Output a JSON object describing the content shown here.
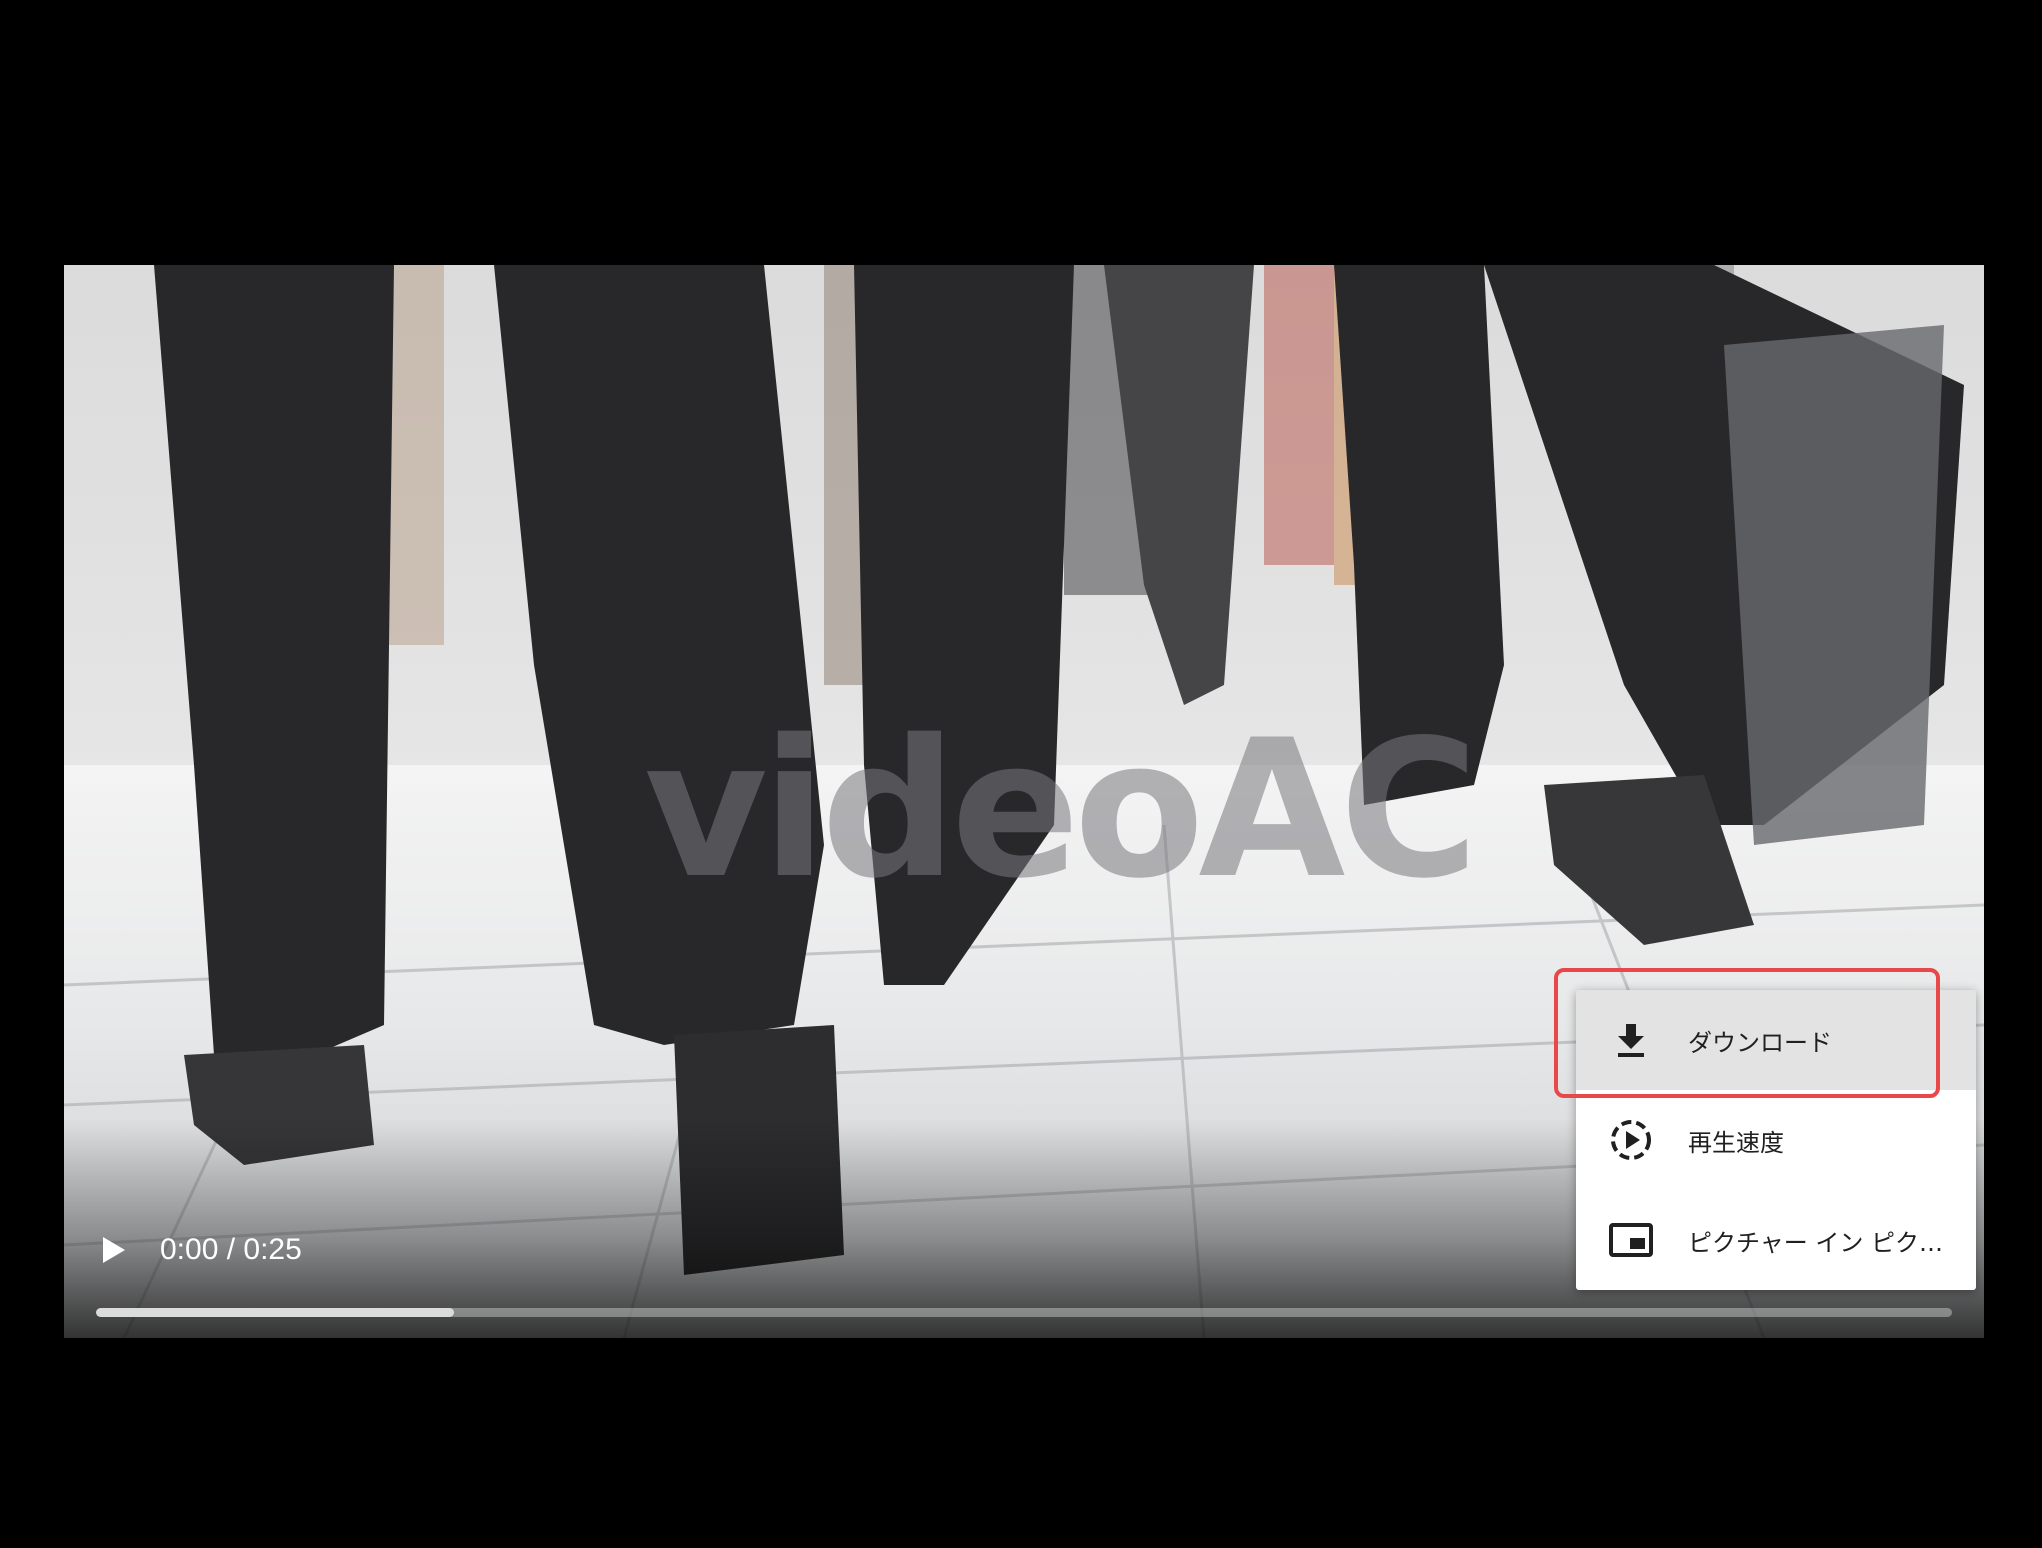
{
  "player": {
    "watermark": "videoAC",
    "current_time": "0:00",
    "separator": "/",
    "duration": "0:25",
    "time_display": "0:00 / 0:25",
    "progress_buffered_fraction": 0.193,
    "progress_played_fraction": 0.0
  },
  "menu": {
    "items": [
      {
        "label": "ダウンロード",
        "icon": "download-icon",
        "highlighted": true
      },
      {
        "label": "再生速度",
        "icon": "playback-speed-icon",
        "highlighted": false
      },
      {
        "label": "ピクチャー イン ピクチャー",
        "icon": "picture-in-picture-icon",
        "highlighted": false
      }
    ]
  },
  "colors": {
    "background": "#000000",
    "menu_background": "#ffffff",
    "menu_hover": "#e3e3e3",
    "highlight_box": "#e8484a",
    "controls_text": "#ffffff"
  }
}
